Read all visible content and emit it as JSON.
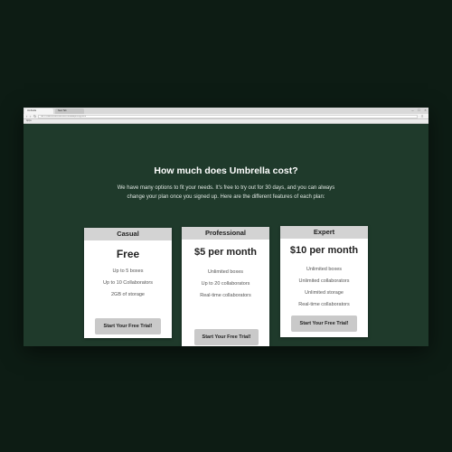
{
  "browser": {
    "tabs": [
      {
        "label": "Umbrella"
      },
      {
        "label": "New Tab"
      }
    ],
    "url": "file:///Users/Documents/Umbrella/pricing.html",
    "bookmarks": "Apps"
  },
  "pricing": {
    "heading": "How much does Umbrella cost?",
    "intro": "We have many options to fit your needs. It's free to try out for 30 days, and you can always change your plan once you signed up. Here are the different features of each plan:",
    "plans": [
      {
        "name": "Casual",
        "price": "Free",
        "features": [
          "Up to 5 boxes",
          "Up to 10 Collaborators",
          "2GB of storage"
        ],
        "cta": "Start Your Free Trial!"
      },
      {
        "name": "Professional",
        "price": "$5 per month",
        "features": [
          "Unlimited boxes",
          "Up to 20 collaborators",
          "Real-time collaborators"
        ],
        "cta": "Start Your Free Trial!"
      },
      {
        "name": "Expert",
        "price": "$10 per month",
        "features": [
          "Unlimited boxes",
          "Unlimited collaborators",
          "Unlimited storage",
          "Real-time collaborators"
        ],
        "cta": "Start Your Free Trial!"
      }
    ]
  },
  "colors": {
    "page_background": "#0d1c14",
    "content_background": "#1f3a2b",
    "card_header": "#d3d3d3",
    "button": "#c9c9c9"
  }
}
